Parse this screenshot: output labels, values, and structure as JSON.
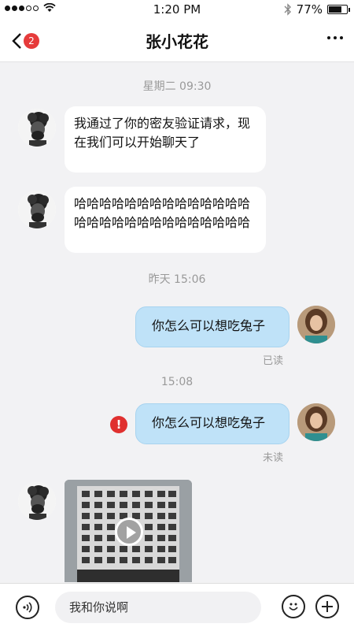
{
  "status_bar": {
    "time": "1:20 PM",
    "battery": "77%",
    "battery_level": 0.77
  },
  "header": {
    "title": "张小花花",
    "back_badge": "2"
  },
  "messages": [
    {
      "time": "星期二   09:30"
    },
    {
      "text": "我通过了你的密友验证请求，现在我们可以开始聊天了"
    },
    {
      "text": "哈哈哈哈哈哈哈哈哈哈哈哈哈哈哈哈哈哈哈哈哈哈哈哈哈哈哈哈"
    },
    {
      "time": "昨天   15:06"
    },
    {
      "text": "你怎么可以想吃兔子",
      "status": "已读"
    },
    {
      "time": "15:08"
    },
    {
      "text": "你怎么可以想吃兔子",
      "status": "未读"
    }
  ],
  "input": {
    "placeholder": "我和你说啊"
  },
  "colors": {
    "outgoing_bubble": "#bfe2f8",
    "error": "#e0302f",
    "badge": "#e63b3b"
  }
}
